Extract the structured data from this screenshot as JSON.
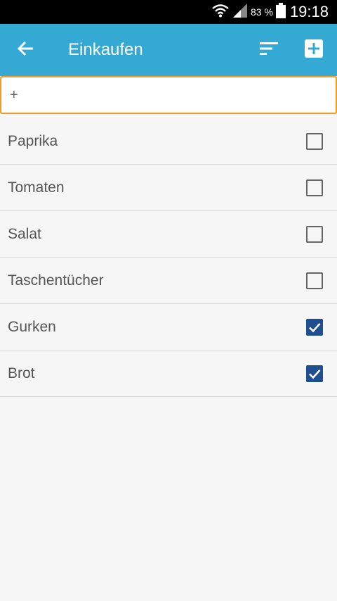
{
  "status_bar": {
    "battery_percent": "83 %",
    "time": "19:18",
    "icons": [
      "wifi-icon",
      "signal-icon",
      "battery-icon"
    ]
  },
  "app_bar": {
    "title": "Einkaufen",
    "icons": [
      "back-arrow-icon",
      "sort-icon",
      "add-box-icon"
    ],
    "color": "#33a9d4"
  },
  "new_item_input": {
    "value": "",
    "placeholder": "+"
  },
  "items": [
    {
      "label": "Paprika",
      "checked": false
    },
    {
      "label": "Tomaten",
      "checked": false
    },
    {
      "label": "Salat",
      "checked": false
    },
    {
      "label": "Taschentücher",
      "checked": false
    },
    {
      "label": "Gurken",
      "checked": true
    },
    {
      "label": "Brot",
      "checked": true
    }
  ],
  "colors": {
    "accent": "#33a9d4",
    "input_border": "#f59a23",
    "checkbox_checked": "#1f4f8f"
  }
}
